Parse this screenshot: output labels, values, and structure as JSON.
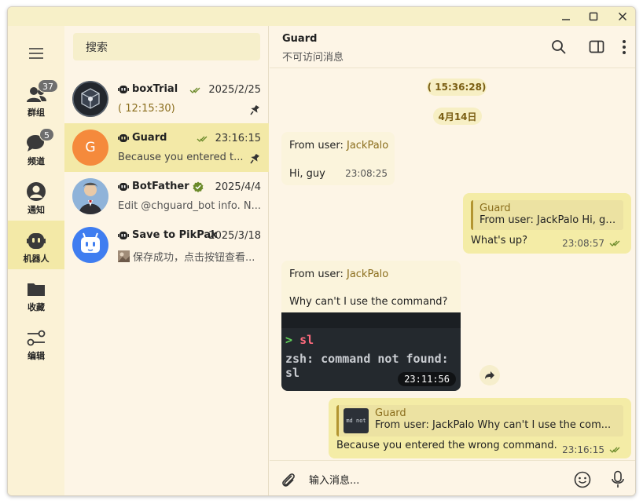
{
  "sidebar": {
    "items": [
      {
        "label": "群组",
        "badge": "37"
      },
      {
        "label": "频道",
        "badge": "5"
      },
      {
        "label": "通知",
        "badge": ""
      },
      {
        "label": "机器人",
        "badge": ""
      },
      {
        "label": "收藏",
        "badge": ""
      },
      {
        "label": "编辑",
        "badge": ""
      }
    ]
  },
  "chatlist": {
    "search_placeholder": "搜索",
    "chats": [
      {
        "name": "boxTrial",
        "time": "2025/2/25",
        "preview": "( 12:15:30)",
        "pinned": true,
        "read": true
      },
      {
        "name": "Guard",
        "time": "23:16:15",
        "preview": "Because you entered t...",
        "pinned": true,
        "read": true,
        "avatar_letter": "G"
      },
      {
        "name": "BotFather",
        "time": "2025/4/4",
        "preview": "Edit @chguard_bot info.  N...",
        "verified": true
      },
      {
        "name": "Save to PikPak",
        "time": "2025/3/18",
        "preview": "保存成功，点击按钮查看..."
      }
    ]
  },
  "header": {
    "title": "Guard",
    "subtitle": "不可访问消息"
  },
  "messages": {
    "pill_time": "( 15:36:28)",
    "date_pill": "4月14日",
    "m1": {
      "prefix": "From user: ",
      "user": "JackPalo",
      "text": "Hi, guy",
      "time": "23:08:25"
    },
    "m2": {
      "quote_name": "Guard",
      "quote_text": "From user: JackPalo   Hi, guy",
      "text": "What's up?",
      "time": "23:08:57"
    },
    "m3": {
      "prefix": "From user: ",
      "user": "JackPalo",
      "text": "Why can't I use the command?",
      "term_prompt": ">",
      "term_cmd": "sl",
      "term_error": "zsh: command not found: sl",
      "time": "23:11:56"
    },
    "m4": {
      "quote_name": "Guard",
      "quote_thumb": "md not",
      "quote_text": "From user: JackPalo   Why can't I use the com...",
      "text": "Because you entered the wrong command.",
      "time": "23:16:15"
    }
  },
  "composer": {
    "placeholder": "输入消息..."
  },
  "colors": {
    "accent": "#8a6d1c",
    "active_bg": "#f3e9a7",
    "outgoing_bg": "#f4eca6",
    "terminal_bg": "#24292e",
    "guard_avatar": "#f58a3c",
    "pikpak_avatar": "#3f7df0"
  }
}
